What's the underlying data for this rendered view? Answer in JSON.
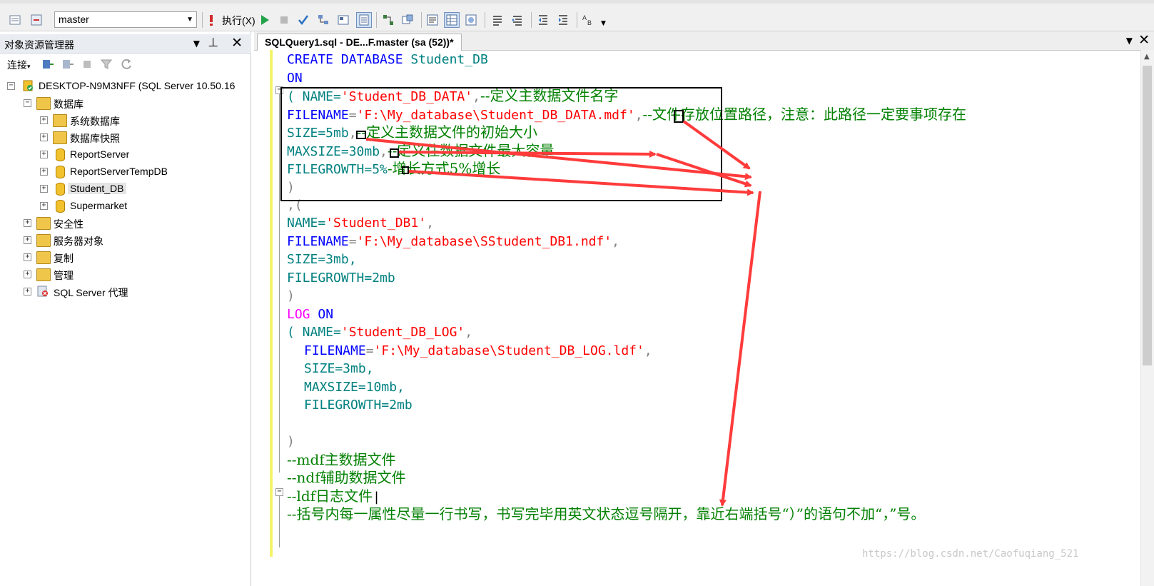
{
  "toolbar": {
    "database_combo": "master",
    "execute_label": "执行(X)"
  },
  "explorer": {
    "title": "对象资源管理器",
    "connect_label": "连接",
    "server": "DESKTOP-N9M3NFF (SQL Server 10.50.16",
    "databases_label": "数据库",
    "db_items": [
      "系统数据库",
      "数据库快照",
      "ReportServer",
      "ReportServerTempDB",
      "Student_DB",
      "Supermarket"
    ],
    "other_items": [
      "安全性",
      "服务器对象",
      "复制",
      "管理",
      "SQL Server 代理"
    ]
  },
  "editor": {
    "tab_label": "SQLQuery1.sql - DE...F.master (sa (52))*",
    "code": {
      "l1_kw": "CREATE DATABASE",
      "l1_name": "Student_DB",
      "l2": "ON",
      "l3_a": "( NAME=",
      "l3_str": "'Student_DB_DATA'",
      "l3_b": ",",
      "l3_cm": "--定义主数据文件名字",
      "l4_kw": "FILENAME",
      "l4_eq": "=",
      "l4_str": "'F:\\My_database\\Student_DB_DATA.mdf'",
      "l4_b": ",",
      "l4_cm": "--文件存放位置路径，注意：此路径一定要事项存在",
      "l5_a": "SIZE=5mb",
      "l5_b": ",",
      "l5_cm": "--定义主数据文件的初始大小",
      "l6_a": "MAXSIZE=30mb",
      "l6_b": ",",
      "l6_cm": "--定义住数据文件最大容量",
      "l7_a": "FILEGROWTH=5%",
      "l7_cm": "-增长方式5%增长",
      "l8": ")",
      "l9": ",(",
      "l10_a": "NAME=",
      "l10_str": "'Student_DB1'",
      "l10_b": ",",
      "l11_kw": "FILENAME",
      "l11_eq": "=",
      "l11_str": "'F:\\My_database\\SStudent_DB1.ndf'",
      "l11_b": ",",
      "l12": "SIZE=3mb,",
      "l13": "FILEGROWTH=2mb",
      "l14": ")",
      "l15_log": "LOG",
      "l15_on": "ON",
      "l16_a": "( NAME=",
      "l16_str": "'Student_DB_LOG'",
      "l16_b": ",",
      "l17_kw": "FILENAME",
      "l17_eq": "=",
      "l17_str": "'F:\\My_database\\Student_DB_LOG.ldf'",
      "l17_b": ",",
      "l18": "SIZE=3mb,",
      "l19": "MAXSIZE=10mb,",
      "l20": "FILEGROWTH=2mb",
      "l21": ")",
      "c1": "--mdf主数据文件",
      "c2": "--ndf辅助数据文件",
      "c3": "--ldf日志文件",
      "c4": "--括号内每一属性尽量一行书写，书写完毕用英文状态逗号隔开，靠近右端括号“）”的语句不加“，”号。"
    }
  },
  "watermark": "https://blog.csdn.net/Caofuqiang_521",
  "colors": {
    "keyword": "#0000ff",
    "string": "#ff0000",
    "comment": "#008000",
    "arrow": "#ff3b3b",
    "margin": "#f5f36a"
  }
}
